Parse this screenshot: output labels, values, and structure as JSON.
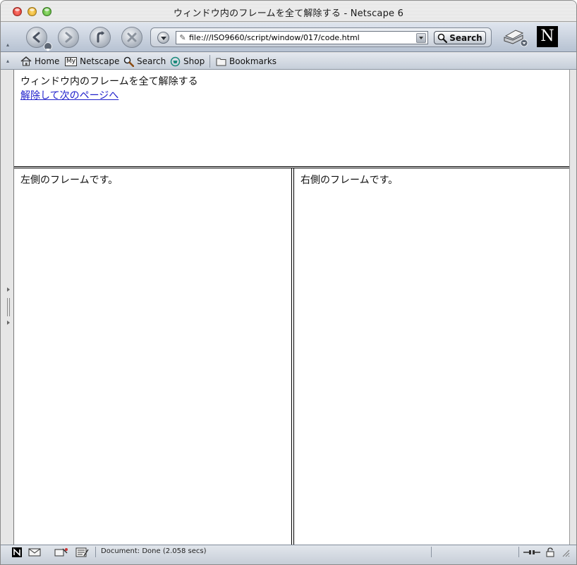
{
  "window": {
    "title": "ウィンドウ内のフレームを全て解除する - Netscape 6"
  },
  "navbar": {
    "back_icon": "back-arrow-icon",
    "forward_icon": "forward-arrow-icon",
    "reload_icon": "reload-icon",
    "stop_icon": "stop-icon",
    "url_value": "file:///ISO9660/script/window/017/code.html",
    "search_label": "Search"
  },
  "personal_toolbar": {
    "items": [
      {
        "label": "Home",
        "icon": "home-icon"
      },
      {
        "label": "Netscape",
        "icon": "my-netscape-icon",
        "badge": "My"
      },
      {
        "label": "Search",
        "icon": "magnifier-icon"
      },
      {
        "label": "Shop",
        "icon": "shop-icon"
      },
      {
        "label": "Bookmarks",
        "icon": "bookmarks-folder-icon"
      }
    ]
  },
  "frames": {
    "top": {
      "heading": "ウィンドウ内のフレームを全て解除する",
      "link": "解除して次のページへ"
    },
    "left": {
      "text": "左側のフレームです。"
    },
    "right": {
      "text": "右側のフレームです。"
    }
  },
  "status": {
    "text": "Document: Done (2.058 secs)"
  },
  "colors": {
    "link": "#2222cc",
    "toolbar_top": "#dfe5ee",
    "toolbar_bottom": "#b7c2d2"
  }
}
